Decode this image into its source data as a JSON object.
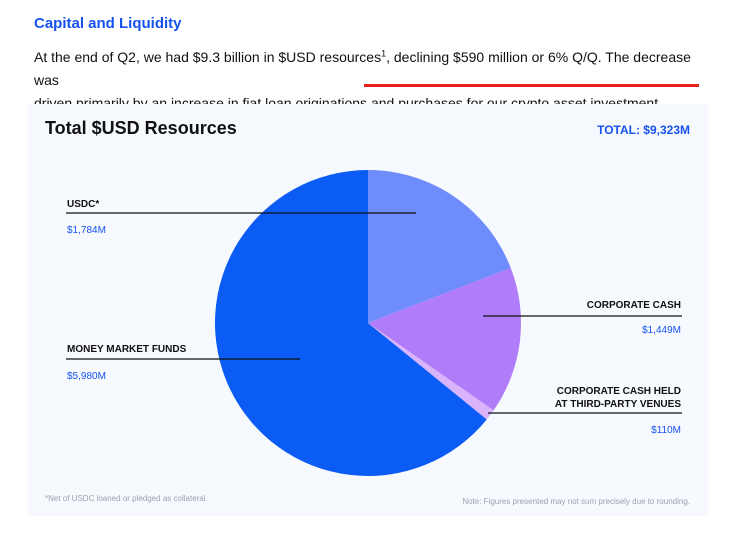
{
  "section": {
    "heading": "Capital and Liquidity",
    "paragraph_line1_a": "At the end of Q2, we had $9.3 billion in $USD resources",
    "paragraph_sup": "1",
    "paragraph_line1_b": ", declining $590 million or 6% Q/Q. The decrease was",
    "paragraph_line2": "driven primarily by an increase in fiat loan originations and purchases for our crypto asset investment portfolio."
  },
  "colors": {
    "accent": "#1652f0",
    "underline": "#e8221b",
    "money_market": "#0b5cf5",
    "usdc": "#6e8cfb",
    "corporate_cash": "#b07cf9",
    "third_party": "#d9b3fb"
  },
  "chart_data": {
    "type": "pie",
    "title": "Total $USD Resources",
    "total_label": "TOTAL: $9,323M",
    "series": [
      {
        "name": "USDC*",
        "value": 1784,
        "label": "$1,784M",
        "color": "#6e8cfb"
      },
      {
        "name": "CORPORATE CASH",
        "value": 1449,
        "label": "$1,449M",
        "color": "#b07cf9"
      },
      {
        "name": "CORPORATE CASH HELD AT THIRD-PARTY VENUES",
        "value": 110,
        "label": "$110M",
        "color": "#d9b3fb"
      },
      {
        "name": "MONEY MARKET FUNDS",
        "value": 5980,
        "label": "$5,980M",
        "color": "#0b5cf5"
      }
    ],
    "start": "12 o'clock",
    "direction": "clockwise",
    "footnote": "*Net of USDC loaned or pledged as collateral.",
    "note": "Note: Figures presented may not sum precisely due to rounding."
  },
  "labels": {
    "usdc_name": "USDC*",
    "usdc_value": "$1,784M",
    "corp_name": "CORPORATE CASH",
    "corp_value": "$1,449M",
    "third_line1": "CORPORATE CASH HELD",
    "third_line2": "AT THIRD-PARTY VENUES",
    "third_value": "$110M",
    "mmf_name": "MONEY MARKET FUNDS",
    "mmf_value": "$5,980M"
  }
}
